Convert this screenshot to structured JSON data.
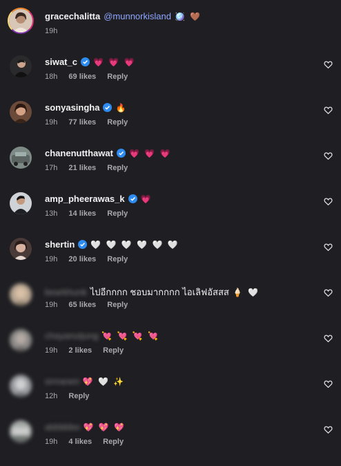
{
  "comments": [
    {
      "username": "gracechalitta",
      "text": "@munnorkisland",
      "emoji": "🪩 🤎",
      "time": "19h",
      "likes": "",
      "reply": ""
    },
    {
      "username": "siwat_c",
      "text": "",
      "emoji": "💗 💗 💗",
      "time": "18h",
      "likes": "69 likes",
      "reply": "Reply"
    },
    {
      "username": "sonyasingha",
      "text": "",
      "emoji": "🔥",
      "time": "19h",
      "likes": "77 likes",
      "reply": "Reply"
    },
    {
      "username": "chanenutthawat",
      "text": "",
      "emoji": "💗 💗 💗",
      "time": "17h",
      "likes": "21 likes",
      "reply": "Reply"
    },
    {
      "username": "amp_pheerawas_k",
      "text": "",
      "emoji": "💗",
      "time": "13h",
      "likes": "14 likes",
      "reply": "Reply"
    },
    {
      "username": "shertin",
      "text": "",
      "emoji": "🤍 🤍 🤍 🤍 🤍 🤍",
      "time": "19h",
      "likes": "20 likes",
      "reply": "Reply"
    },
    {
      "username": "bearkhunk",
      "text": "ไปอีกกกก ชอบมากกกก ไอเลิฟอัสสส",
      "emoji": "🍦 🤍",
      "time": "19h",
      "likes": "65 likes",
      "reply": "Reply"
    },
    {
      "username": "chayanutjung",
      "text": "",
      "emoji": "💘 💘 💘 💘",
      "time": "19h",
      "likes": "2 likes",
      "reply": "Reply"
    },
    {
      "username": "siriranen",
      "text": "",
      "emoji": "💖 🤍 ✨",
      "time": "12h",
      "likes": "",
      "reply": "Reply"
    },
    {
      "username": "abbbbbo",
      "text": "",
      "emoji": "💖 💖 💖",
      "time": "19h",
      "likes": "4 likes",
      "reply": "Reply"
    }
  ]
}
